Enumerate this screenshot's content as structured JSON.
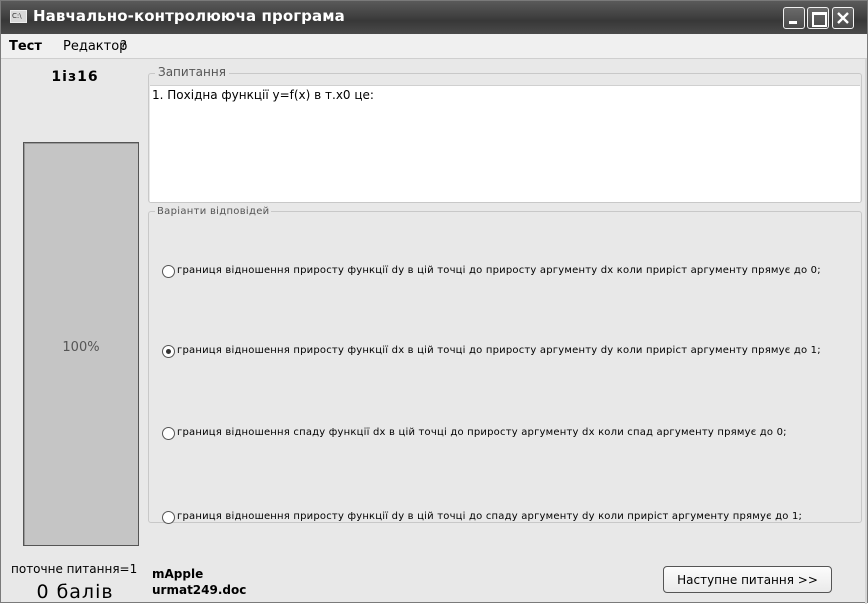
{
  "window": {
    "title": "Навчально-контролююча програма",
    "icon": "app-icon"
  },
  "menu": {
    "test": "Тест",
    "editor": "Редактор",
    "help": "?"
  },
  "progress": {
    "counter": "1із16",
    "percent_label": "100%",
    "percent_value": 1.0,
    "current_question": "поточне питання=1",
    "score": "0 балів"
  },
  "question": {
    "legend": "Запитання",
    "text": "1. Похідна функції y=f(x) в т.x0 це:"
  },
  "answers": {
    "legend": "Варіанти відповідей",
    "options": [
      {
        "label": "границя відношення приросту функції dy в цій точці до приросту аргументу dx коли приріст аргументу прямує до 0;",
        "checked": false
      },
      {
        "label": "границя відношення приросту функції dx в цій точці до приросту аргументу dy коли приріст аргументу прямує до 1;",
        "checked": true
      },
      {
        "label": "границя відношення спаду функції dx в цій точці до приросту аргументу dx коли спад аргументу прямує до 0;",
        "checked": false
      },
      {
        "label": "границя відношення приросту функції dy в цій точці до спаду аргументу dy коли приріст аргументу прямує до 1;",
        "checked": false
      }
    ]
  },
  "footer": {
    "line1": "mApple",
    "line2": "urmat249.doc",
    "next_button": "Наступне питання >>"
  }
}
